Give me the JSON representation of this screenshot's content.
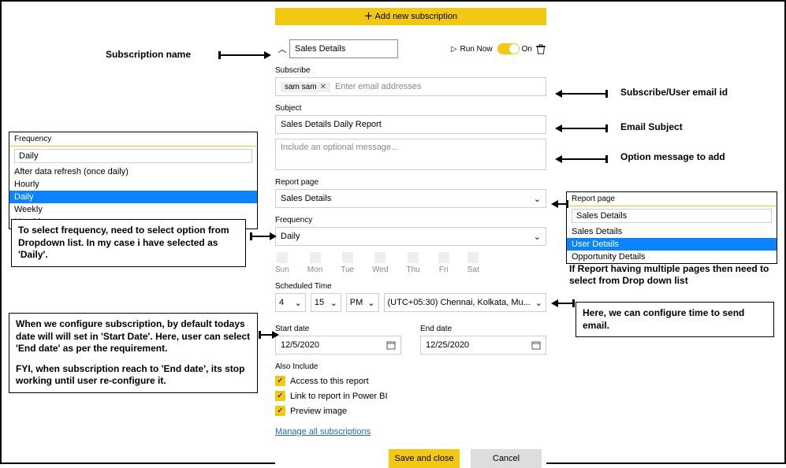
{
  "topbar": {
    "add_label": "Add new subscription"
  },
  "header": {
    "name_value": "Sales Details",
    "run_now": "Run Now",
    "toggle_label": "On"
  },
  "subscribe": {
    "label": "Subscribe",
    "chip": "sam sam",
    "placeholder": "Enter email addresses"
  },
  "subject": {
    "label": "Subject",
    "value": "Sales Details Daily Report"
  },
  "message": {
    "placeholder": "Include an optional message..."
  },
  "report_page": {
    "label": "Report page",
    "value": "Sales Details"
  },
  "frequency": {
    "label": "Frequency",
    "value": "Daily"
  },
  "days": [
    "Sun",
    "Mon",
    "Tue",
    "Wed",
    "Thu",
    "Fri",
    "Sat"
  ],
  "sched": {
    "label": "Scheduled Time",
    "hour": "4",
    "minute": "15",
    "ampm": "PM",
    "tz": "(UTC+05:30) Chennai, Kolkata, Mu..."
  },
  "dates": {
    "start_label": "Start date",
    "end_label": "End date",
    "start": "12/5/2020",
    "end": "12/25/2020"
  },
  "include": {
    "label": "Also Include",
    "opt1": "Access to this report",
    "opt2": "Link to report in Power BI",
    "opt3": "Preview image"
  },
  "link_manage": "Manage all subscriptions",
  "buttons": {
    "save": "Save and close",
    "cancel": "Cancel"
  },
  "freq_pop": {
    "header": "Frequency",
    "input": "Daily",
    "opts": [
      "After data refresh (once daily)",
      "Hourly",
      "Daily",
      "Weekly",
      "Monthly"
    ]
  },
  "page_pop": {
    "header": "Report page",
    "input": "Sales Details",
    "opts": [
      "Sales Details",
      "User Details",
      "Opportunity Details"
    ]
  },
  "annotations": {
    "name": "Subscription name",
    "email": "Subscribe/User email id",
    "subject": "Email Subject",
    "message": "Option message to add",
    "freq_text": "To select frequency, need to select option from Dropdown list. In my case i have selected as 'Daily'.",
    "page_text": "If Report having multiple pages then need to select from Drop down list",
    "time_text": "Here, we can configure time to send email.",
    "date_text1": "When we configure subscription, by default todays date will will set in 'Start Date'. Here, user can select 'End date' as per the requirement.",
    "date_text2": "FYI, when subscription reach to 'End date', its stop working until user re-configure it."
  }
}
